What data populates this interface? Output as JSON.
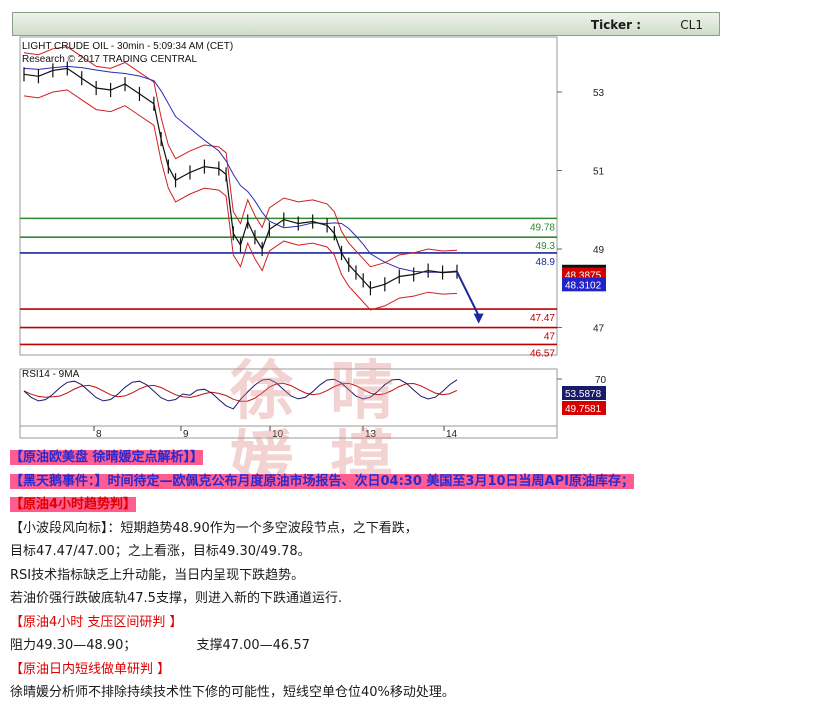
{
  "ticker": {
    "label": "Ticker :",
    "value": "CL1"
  },
  "chart_data": {
    "type": "line",
    "title": "LIGHT CRUDE OIL - 30min - 5:09:34 AM (CET)",
    "subtitle": "Research © 2017 TRADING CENTRAL",
    "y_ticks": [
      "53",
      "51",
      "49",
      "47"
    ],
    "ylim": [
      46.3,
      54.4
    ],
    "x_ticks": [
      "8",
      "9",
      "10",
      "13",
      "14"
    ],
    "price_series": [
      {
        "x": 0,
        "y": 53.45
      },
      {
        "x": 2,
        "y": 53.4
      },
      {
        "x": 4,
        "y": 53.55
      },
      {
        "x": 6,
        "y": 53.6
      },
      {
        "x": 8,
        "y": 53.35
      },
      {
        "x": 10,
        "y": 53.1
      },
      {
        "x": 12,
        "y": 53.05
      },
      {
        "x": 14,
        "y": 53.2
      },
      {
        "x": 16,
        "y": 52.95
      },
      {
        "x": 18,
        "y": 52.7
      },
      {
        "x": 19,
        "y": 51.8
      },
      {
        "x": 20,
        "y": 51.1
      },
      {
        "x": 21,
        "y": 50.75
      },
      {
        "x": 23,
        "y": 50.95
      },
      {
        "x": 25,
        "y": 51.1
      },
      {
        "x": 27,
        "y": 51.05
      },
      {
        "x": 28,
        "y": 50.9
      },
      {
        "x": 29,
        "y": 49.4
      },
      {
        "x": 30,
        "y": 49.1
      },
      {
        "x": 31,
        "y": 49.7
      },
      {
        "x": 32,
        "y": 49.3
      },
      {
        "x": 33,
        "y": 49.0
      },
      {
        "x": 34,
        "y": 49.5
      },
      {
        "x": 36,
        "y": 49.75
      },
      {
        "x": 38,
        "y": 49.65
      },
      {
        "x": 40,
        "y": 49.7
      },
      {
        "x": 42,
        "y": 49.6
      },
      {
        "x": 43,
        "y": 49.4
      },
      {
        "x": 44,
        "y": 48.9
      },
      {
        "x": 45,
        "y": 48.6
      },
      {
        "x": 46,
        "y": 48.4
      },
      {
        "x": 47,
        "y": 48.2
      },
      {
        "x": 48,
        "y": 48.0
      },
      {
        "x": 50,
        "y": 48.1
      },
      {
        "x": 52,
        "y": 48.3
      },
      {
        "x": 54,
        "y": 48.35
      },
      {
        "x": 56,
        "y": 48.45
      },
      {
        "x": 58,
        "y": 48.4
      },
      {
        "x": 60,
        "y": 48.42
      }
    ],
    "projection": {
      "from": [
        60,
        48.42
      ],
      "to": [
        63,
        47.15
      ]
    },
    "levels": [
      {
        "value": "49.78",
        "y": 49.78,
        "color": "#2e8b2e"
      },
      {
        "value": "49.3",
        "y": 49.3,
        "color": "#2e8b2e"
      },
      {
        "value": "48.9",
        "y": 48.9,
        "color": "#1a2a9a"
      },
      {
        "value": "47.47",
        "y": 47.47,
        "color": "#c00000"
      },
      {
        "value": "47",
        "y": 47.0,
        "color": "#c00000"
      },
      {
        "value": "46.57",
        "y": 46.57,
        "color": "#c00000"
      }
    ],
    "price_tags": [
      {
        "value": "48.42",
        "y": 48.42,
        "bg": "#111111"
      },
      {
        "value": "48.3875",
        "y": 48.35,
        "bg": "#d40000"
      },
      {
        "value": "48.3102",
        "y": 48.1,
        "bg": "#2222c8"
      }
    ],
    "rsi": {
      "title": "RSI14 - 9MA",
      "y_tick": "70",
      "tags": [
        {
          "value": "53.5878",
          "bg": "#1a1a6a"
        },
        {
          "value": "49.7581",
          "bg": "#d40000"
        }
      ]
    }
  },
  "article": {
    "line1": "【原油欧美盘 徐晴媛定点解析】】",
    "line2_head": "【黑天鹅事件：】",
    "line2_body": "时间待定—欧佩克公布月度原油市场报告、次日04:30 美国至3月10日当周API原油库存；",
    "line3": "【原油4小时趋势判】",
    "line4": "【小波段风向标】：短期趋势48.90作为一个多空波段节点，之下看跌，",
    "line5": "目标47.47/47.00；之上看涨，目标49.30/49.78。",
    "line6": "RSI技术指标缺乏上升动能，当日内呈现下跌趋势。",
    "line7": "若油价强行跌破底轨47.5支撑，则进入新的下跌通道运行.",
    "line8": "【原油4小时 支压区间研判 】",
    "line9_a": "阻力49.30—48.90；",
    "line9_b": "支撑47.00—46.57",
    "line10": "【原油日内短线做单研判 】",
    "line11": "徐晴媛分析师不排除持续技术性下修的可能性，短线空单仓位40%移动处理。"
  },
  "watermark": [
    "徐",
    "晴",
    "媛",
    "摸"
  ]
}
